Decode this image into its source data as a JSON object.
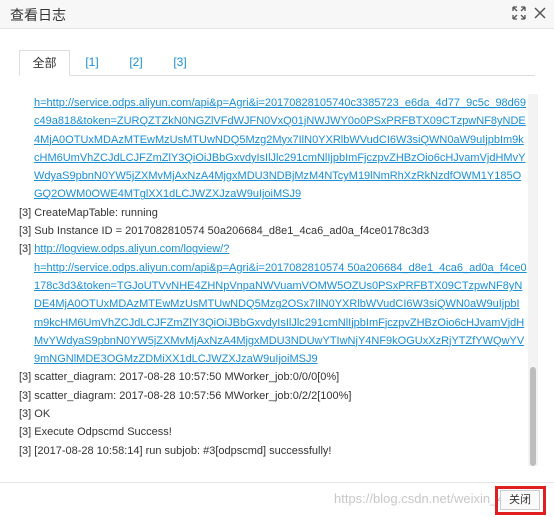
{
  "title": "查看日志",
  "titlebar": {
    "maximize_icon": "expand-arrows-icon",
    "close_icon": "close-x-icon"
  },
  "tabs": [
    {
      "label": "全部",
      "active": true
    },
    {
      "label": "[1]",
      "active": false
    },
    {
      "label": "[2]",
      "active": false
    },
    {
      "label": "[3]",
      "active": false
    }
  ],
  "log_lines": [
    {
      "prefix": "",
      "link": "h=http://service.odps.aliyun.com/api&p=Agri&i=20170828105740c3385723_e6da_4d77_9c5c_98d69",
      "indent": true
    },
    {
      "prefix": "",
      "link": "c49a818&token=ZURQZTZkN0NGZlVFdWJFN0VxQ01jNWJWY0o0PSxPRFBTX09CTzpwNF8yNDE",
      "indent": true
    },
    {
      "prefix": "",
      "link": "4MjA0OTUxMDAzMTEwMzUsMTUwNDQ5Mzg2Myx7IlN0YXRlbWVudCI6W3siQWN0aW9uIjpbIm9k",
      "indent": true
    },
    {
      "prefix": "",
      "link": "cHM6UmVhZCJdLCJFZmZlY3QiOiJBbGxvdyIsIlJlc291cmNlIjpbImFjczpvZHBzOio6cHJvamVjdHMvY",
      "indent": true
    },
    {
      "prefix": "",
      "link": "WdyaS9pbnN0YW5jZXMvMjAxNzA4MjgxMDU3NDBjMzM4NTcyM19lNmRhXzRkNzdfOWM1Y185O",
      "indent": true
    },
    {
      "prefix": "",
      "link": "GQ2OWM0OWE4MTglXX1dLCJWZXJzaW9uIjoiMSJ9",
      "indent": true
    },
    {
      "prefix": "[3] CreateMapTable: running",
      "link": "",
      "indent": false
    },
    {
      "prefix": "[3] Sub Instance ID = 2017082810574 50a206684_d8e1_4ca6_ad0a_f4ce0178c3d3",
      "link": "",
      "indent": false
    },
    {
      "prefix": "[3] ",
      "link": "http://logview.odps.aliyun.com/logview/?",
      "indent": false
    },
    {
      "prefix": "",
      "link": "h=http://service.odps.aliyun.com/api&p=Agri&i=2017082810574 50a206684_d8e1_4ca6_ad0a_f4ce0",
      "indent": true
    },
    {
      "prefix": "",
      "link": "178c3d3&token=TGJoUTVvNHE4ZHNpVnpaNWVuamVOMW5OZUs0PSxPRFBTX09CTzpwNF8yN",
      "indent": true
    },
    {
      "prefix": "",
      "link": "DE4MjA0OTUxMDAzMTEwMzUsMTUwNDQ5Mzg2OSx7IlN0YXRlbWVudCI6W3siQWN0aW9uIjpbI",
      "indent": true
    },
    {
      "prefix": "",
      "link": "m9kcHM6UmVhZCJdLCJFZmZlY3QiOiJBbGxvdyIsIlJlc291cmNlIjpbImFjczpvZHBzOio6cHJvamVjdH",
      "indent": true
    },
    {
      "prefix": "",
      "link": "MvYWdyaS9pbnN0YW5jZXMvMjAxNzA4MjgxMDU3NDUwYTIwNjY4NF9kOGUxXzRjYTZfYWQwYV",
      "indent": true
    },
    {
      "prefix": "",
      "link": "9mNGNlMDE3OGMzZDMiXX1dLCJWZXJzaW9uIjoiMSJ9",
      "indent": true
    },
    {
      "prefix": "[3] scatter_diagram: 2017-08-28 10:57:50 MWorker_job:0/0/0[0%]",
      "link": "",
      "indent": false
    },
    {
      "prefix": "[3] scatter_diagram: 2017-08-28 10:57:56 MWorker_job:0/2/2[100%]",
      "link": "",
      "indent": false
    },
    {
      "prefix": "[3] OK",
      "link": "",
      "indent": false
    },
    {
      "prefix": "[3] Execute Odpscmd Success!",
      "link": "",
      "indent": false
    },
    {
      "prefix": "[3] [2017-08-28 10:58:14] run subjob: #3[odpscmd] successfully!",
      "link": "",
      "indent": false
    }
  ],
  "footer": {
    "watermark": "https://blog.csdn.net/weixin_45...",
    "close_label": "关闭"
  },
  "colors": {
    "link": "#1a8fd6",
    "highlight": "#e02020"
  }
}
